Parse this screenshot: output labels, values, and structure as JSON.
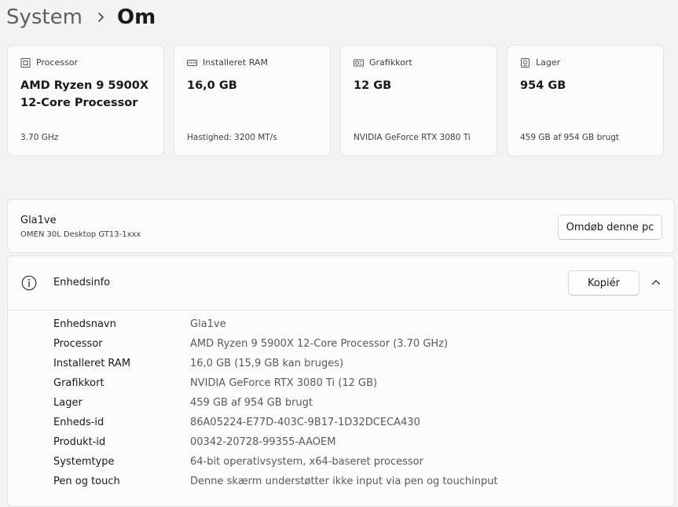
{
  "breadcrumb": {
    "parent": "System",
    "current": "Om"
  },
  "cards": [
    {
      "icon": "cpu-icon",
      "title": "Processor",
      "value": "AMD Ryzen 9 5900X 12-Core Processor",
      "sub": "3.70 GHz"
    },
    {
      "icon": "ram-icon",
      "title": "Installeret RAM",
      "value": "16,0 GB",
      "sub": "Hastighed: 3200 MT/s"
    },
    {
      "icon": "gpu-icon",
      "title": "Grafikkort",
      "value": "12 GB",
      "sub": "NVIDIA GeForce RTX 3080 Ti"
    },
    {
      "icon": "storage-icon",
      "title": "Lager",
      "value": "954 GB",
      "sub": "459 GB af 954 GB brugt"
    }
  ],
  "device": {
    "name": "Gla1ve",
    "model": "OMEN 30L Desktop GT13-1xxx",
    "rename_label": "Omdøb denne pc"
  },
  "device_info": {
    "title": "Enhedsinfo",
    "copy_label": "Kopiér",
    "specs": [
      {
        "label": "Enhedsnavn",
        "value": "Gla1ve"
      },
      {
        "label": "Processor",
        "value": "AMD Ryzen 9 5900X 12-Core Processor (3.70 GHz)"
      },
      {
        "label": "Installeret RAM",
        "value": "16,0 GB (15,9 GB kan bruges)"
      },
      {
        "label": "Grafikkort",
        "value": "NVIDIA GeForce RTX 3080 Ti (12 GB)"
      },
      {
        "label": "Lager",
        "value": "459 GB af 954 GB brugt"
      },
      {
        "label": "Enheds-id",
        "value": "86A05224-E77D-403C-9B17-1D32DCECA430"
      },
      {
        "label": "Produkt-id",
        "value": "00342-20728-99355-AAOEM"
      },
      {
        "label": "Systemtype",
        "value": "64-bit operativsystem, x64-baseret processor"
      },
      {
        "label": "Pen og touch",
        "value": "Denne skærm understøtter ikke input via pen og touchinput"
      }
    ]
  }
}
